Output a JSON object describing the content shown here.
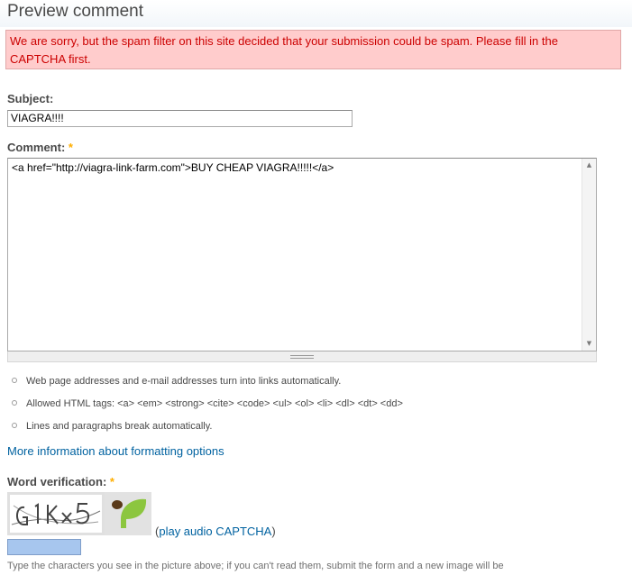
{
  "page": {
    "title": "Preview comment"
  },
  "messages": {
    "error": "We are sorry, but the spam filter on this site decided that your submission could be spam. Please fill in the CAPTCHA first."
  },
  "form": {
    "subject": {
      "label": "Subject:",
      "value": "VIAGRA!!!!"
    },
    "comment": {
      "label": "Comment:",
      "required_marker": "*",
      "value": "<a href=\"http://viagra-link-farm.com\">BUY CHEAP VIAGRA!!!!!</a>"
    },
    "filter_tips": [
      "Web page addresses and e-mail addresses turn into links automatically.",
      "Allowed HTML tags: <a> <em> <strong> <cite> <code> <ul> <ol> <li> <dl> <dt> <dd>",
      "Lines and paragraphs break automatically."
    ],
    "more_info_link": "More information about formatting options",
    "captcha": {
      "label": "Word verification:",
      "required_marker": "*",
      "image_text": "G1KX5",
      "audio_link": "play audio CAPTCHA",
      "audio_open": "(",
      "audio_close": ")",
      "value": "",
      "help": "Type the characters you see in the picture above; if you can't read them, submit the form and a new image will be"
    }
  },
  "colors": {
    "error_bg": "#ffcccc",
    "error_text": "#cc0000",
    "link": "#0062a0",
    "required": "#ffae00",
    "captcha_input_bg": "#a7c6ee",
    "logo_leaf": "#8cc63f",
    "logo_seed": "#5a3a1a"
  },
  "icons": {
    "scroll_up": "triangle-up-icon",
    "scroll_down": "triangle-down-icon",
    "resize": "resize-grip-icon",
    "logo": "leaf-logo-icon"
  }
}
